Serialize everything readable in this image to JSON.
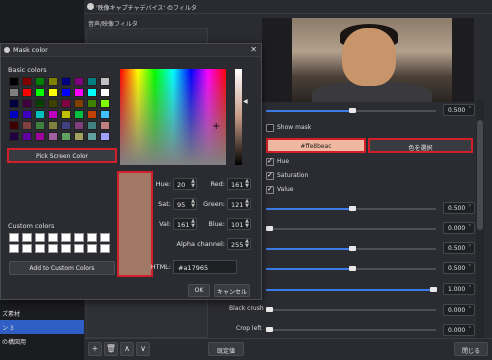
{
  "background_window": {
    "title": "'映像キャプチャデバイス' のフィルタ",
    "filters_heading": "音声/映像フィルタ",
    "left_items": [
      "ズ素材",
      "ン 3",
      "の構図用"
    ],
    "bottom_buttons": {
      "defaults": "既定値",
      "close": "閉じる"
    },
    "bottom_icons": [
      "+",
      "🗑",
      "∧",
      "∨"
    ]
  },
  "properties": {
    "show_mask_label": "Show mask",
    "hex_button": "#ffe8beac",
    "pick_color_button": "色を選択",
    "hue_label": "Hue",
    "saturation_label": "Saturation",
    "value_label": "Value",
    "black_crush_label": "Black crush",
    "crop_left_label": "Crop left",
    "spin_values": [
      "0.500",
      "0.500",
      "0.000",
      "0.500",
      "0.500",
      "1.000",
      "0.000",
      "0.000"
    ],
    "top_spin": "0.500"
  },
  "dialog": {
    "title": "Mask color",
    "close": "✕",
    "basic_colors_label": "Basic colors",
    "pick_screen_color": "Pick Screen Color",
    "custom_colors_label": "Custom colors",
    "add_custom": "Add to Custom Colors",
    "fields": {
      "hue_label": "Hue:",
      "hue": "20",
      "sat_label": "Sat:",
      "sat": "95",
      "val_label": "Val:",
      "val": "161",
      "red_label": "Red:",
      "red": "161",
      "green_label": "Green:",
      "green": "121",
      "blue_label": "Blue:",
      "blue": "101",
      "alpha_label": "Alpha channel:",
      "alpha": "255",
      "html_label": "HTML:",
      "html": "#a17965"
    },
    "ok": "OK",
    "cancel": "キャンセル",
    "current_color": "#a17965",
    "basic_colors": [
      "#000000",
      "#800000",
      "#008000",
      "#808000",
      "#000080",
      "#800080",
      "#008080",
      "#c0c0c0",
      "#808080",
      "#ff0000",
      "#00ff00",
      "#ffff00",
      "#0000ff",
      "#ff00ff",
      "#00ffff",
      "#ffffff",
      "#000040",
      "#400040",
      "#004000",
      "#404000",
      "#800040",
      "#804000",
      "#408000",
      "#80ff00",
      "#0000c0",
      "#4000c0",
      "#00c0c0",
      "#c000c0",
      "#c0c000",
      "#00c040",
      "#c04000",
      "#40c0ff",
      "#400000",
      "#804040",
      "#408040",
      "#808040",
      "#404080",
      "#804080",
      "#408080",
      "#c08080",
      "#200040",
      "#6000a0",
      "#a000a0",
      "#a060a0",
      "#60a060",
      "#a0a060",
      "#60a0a0",
      "#a0a0ff"
    ]
  }
}
